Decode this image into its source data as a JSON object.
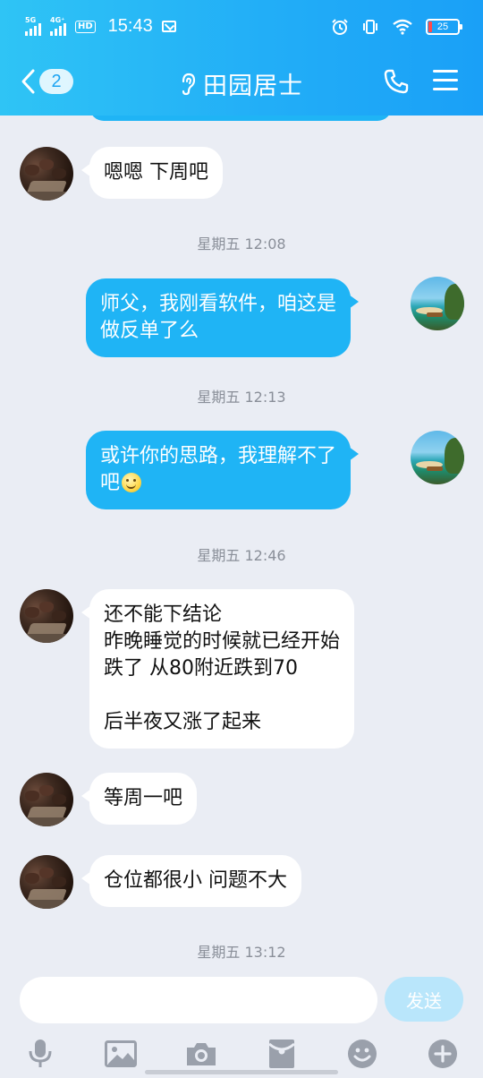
{
  "status_bar": {
    "sig1_label": "5G",
    "sig2_label": "4G⁺",
    "hd_label": "HD",
    "time": "15:43",
    "battery": "25"
  },
  "header": {
    "back_count": "2",
    "title": "田园居士"
  },
  "messages": [
    {
      "side": "in",
      "lines": [
        "嗯嗯 下周吧"
      ]
    },
    {
      "timestamp": "星期五 12:08"
    },
    {
      "side": "out",
      "lines": [
        "师父，我刚看软件，咱这是",
        "做反单了么"
      ]
    },
    {
      "timestamp": "星期五 12:13"
    },
    {
      "side": "out",
      "lines": [
        "或许你的思路，我理解不了",
        "吧"
      ],
      "emoji": "smile-emoji"
    },
    {
      "timestamp": "星期五 12:46"
    },
    {
      "side": "in",
      "lines": [
        "还不能下结论",
        "昨晚睡觉的时候就已经开始",
        "跌了 从80附近跌到70",
        "",
        "后半夜又涨了起来"
      ]
    },
    {
      "side": "in",
      "lines": [
        "等周一吧"
      ]
    },
    {
      "side": "in",
      "lines": [
        "仓位都很小 问题不大"
      ]
    },
    {
      "timestamp": "星期五 13:12"
    }
  ],
  "input": {
    "value": "",
    "send_label": "发送"
  },
  "toolbar": [
    "mic-icon",
    "image-icon",
    "camera-icon",
    "red-packet-icon",
    "emoji-icon",
    "plus-icon"
  ],
  "colors": {
    "header_gradient_start": "#2fc4f5",
    "header_gradient_end": "#1aa0f7",
    "outgoing_bubble": "#1fb4f5",
    "incoming_bubble": "#ffffff",
    "background": "#eaedf4",
    "send_button": "#b9e6fb"
  }
}
